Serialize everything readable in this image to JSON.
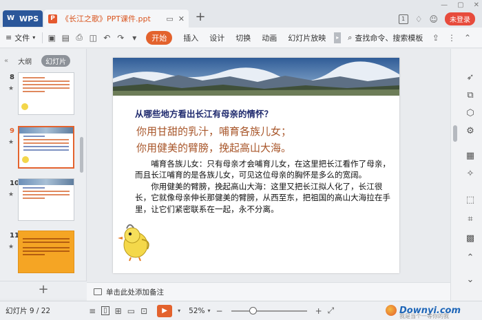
{
  "titlebar": {
    "app_name": "WPS",
    "doc_title": "《长江之歌》PPT课件.ppt",
    "new_tab": "+",
    "login_label": "未登录"
  },
  "toolbar": {
    "file_label": "文件",
    "tabs": [
      {
        "label": "开始",
        "active": true
      },
      {
        "label": "插入"
      },
      {
        "label": "设计"
      },
      {
        "label": "切换"
      },
      {
        "label": "动画"
      },
      {
        "label": "幻灯片放映"
      }
    ],
    "search_label": "查找命令、搜索模板"
  },
  "left_panel": {
    "tabs": [
      "大纲",
      "幻灯片"
    ],
    "thumbnails": [
      {
        "number": "8",
        "star": "★"
      },
      {
        "number": "9",
        "star": "★",
        "active": true
      },
      {
        "number": "10",
        "star": "★"
      },
      {
        "number": "11",
        "star": "★"
      }
    ],
    "add_label": "+"
  },
  "slide": {
    "question": "从哪些地方看出长江有母亲的情怀？",
    "lyric1": "你用甘甜的乳汁，哺育各族儿女；",
    "lyric2": "你用健美的臂膀，挽起高山大海。",
    "para1": "哺育各族儿女：只有母亲才会哺育儿女，在这里把长江看作了母亲，而且长江哺育的是各族儿女，可见这位母亲的胸怀是多么的宽阔。",
    "para2": "你用健美的臂膀，挽起高山大海：这里又把长江拟人化了，长江很长，它就像母亲伸长那健美的臂膀，从西至东，把祖国的高山大海拉在手里，让它们紧密联系在一起，永不分离。"
  },
  "notes": {
    "placeholder": "单击此处添加备注"
  },
  "status": {
    "slide_count": "幻灯片 9 / 22",
    "zoom": "52%",
    "zoom_level": 0.52
  },
  "watermark": {
    "text": "Downyi.com",
    "sub": "我是当个一等你的我"
  },
  "colors": {
    "accent": "#e3622d",
    "wps_blue": "#2b579a",
    "login_red": "#e74b3c",
    "lyric_brown": "#a8562a",
    "question_navy": "#1f2a6e"
  }
}
